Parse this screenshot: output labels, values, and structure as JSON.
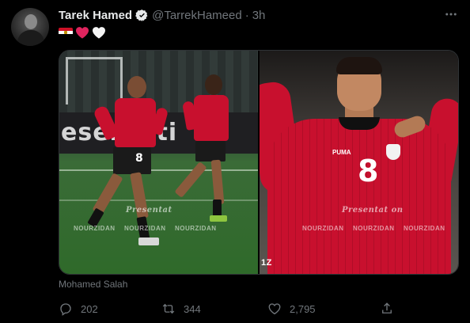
{
  "tweet": {
    "author_name": "Tarek Hamed",
    "handle": "@TarrekHameed",
    "separator": "·",
    "time": "3h",
    "text_emojis": [
      "egypt-flag",
      "red-heart",
      "white-heart"
    ],
    "media_caption": "Mohamed Salah",
    "replies": "202",
    "retweets": "344",
    "likes": "2,795"
  },
  "media": {
    "left": {
      "banner_text": "esentati",
      "watermark_script": "Presentat",
      "watermark_credits": [
        "NOURZIDAN",
        "NOURZIDAN",
        "NOURZIDAN"
      ],
      "shirt_number_front": "8"
    },
    "right": {
      "shirt_number": "8",
      "kit_brand": "PUMA",
      "watermark_script": "Presentat on",
      "watermark_credits": [
        "NOURZIDAN",
        "NOURZIDAN",
        "NOURZIDAN"
      ],
      "corner_logo": "1Z"
    }
  },
  "colors": {
    "background": "#000000",
    "text_primary": "#e7e9ea",
    "text_secondary": "#71767b",
    "verified": "#e7e9ea",
    "heart_red": "#e0245e",
    "egypt_red": "#ce1126"
  },
  "icons": {
    "more": "more-dots-icon",
    "reply": "reply-icon",
    "retweet": "retweet-icon",
    "like": "like-icon",
    "share": "share-icon",
    "verified": "verified-badge-icon"
  }
}
